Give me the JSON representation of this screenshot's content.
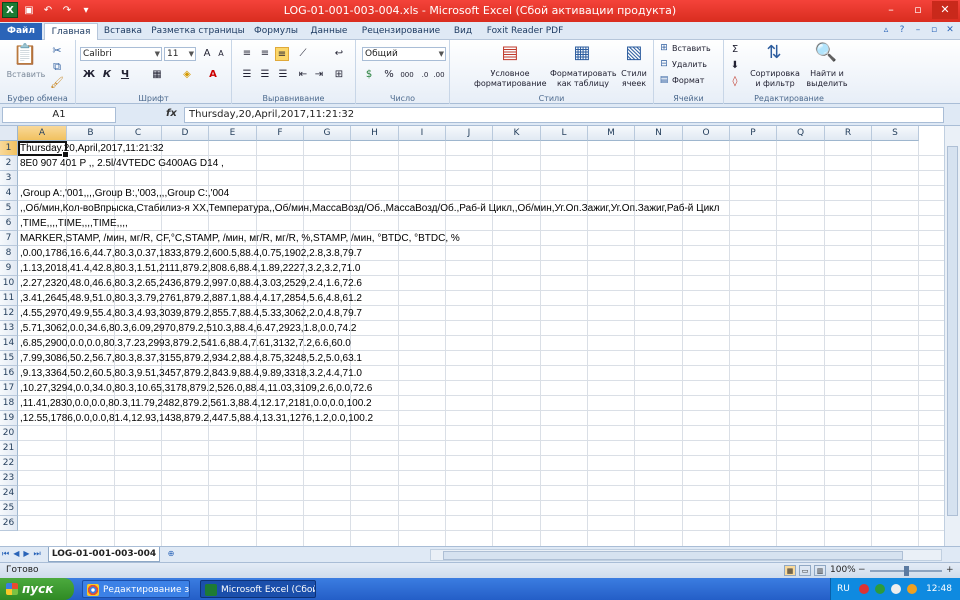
{
  "title": "LOG-01-001-003-004.xls  -  Microsoft Excel (Сбой активации продукта)",
  "tabs": [
    "Файл",
    "Главная",
    "Вставка",
    "Разметка страницы",
    "Формулы",
    "Данные",
    "Рецензирование",
    "Вид",
    "Foxit Reader PDF"
  ],
  "ribbon": {
    "clipboard": {
      "label": "Буфер обмена",
      "paste": "Вставить"
    },
    "font": {
      "label": "Шрифт",
      "name": "Calibri",
      "size": "11",
      "bold": "Ж",
      "italic": "К",
      "underline": "Ч"
    },
    "alignment": {
      "label": "Выравнивание"
    },
    "number": {
      "label": "Число",
      "format": "Общий",
      "percent": "%",
      "thousands": "000"
    },
    "styles": {
      "label": "Стили",
      "cond": "Условное форматирование",
      "cond_l1": "Условное",
      "cond_l2": "форматирование",
      "table_l1": "Форматировать",
      "table_l2": "как таблицу",
      "cell_l1": "Стили",
      "cell_l2": "ячеек"
    },
    "cells": {
      "label": "Ячейки",
      "insert": "Вставить",
      "delete": "Удалить",
      "format": "Формат"
    },
    "editing": {
      "label": "Редактирование",
      "sort_l1": "Сортировка",
      "sort_l2": "и фильтр",
      "find_l1": "Найти и",
      "find_l2": "выделить"
    }
  },
  "namebox": "A1",
  "fx": "fx",
  "formula": "Thursday,20,April,2017,11:21:32",
  "columns": [
    "A",
    "B",
    "C",
    "D",
    "E",
    "F",
    "G",
    "H",
    "I",
    "J",
    "K",
    "L",
    "M",
    "N",
    "O",
    "P",
    "Q",
    "R",
    "S"
  ],
  "rows": [
    "1",
    "2",
    "3",
    "4",
    "5",
    "6",
    "7",
    "8",
    "9",
    "10",
    "11",
    "12",
    "13",
    "14",
    "15",
    "16",
    "17",
    "18",
    "19",
    "20",
    "21",
    "22",
    "23",
    "24",
    "25",
    "26"
  ],
  "cells": [
    "Thursday,20,April,2017,11:21:32",
    "8E0 907 401 P  ,, 2.5l/4VTEDC G400AG D14  ,",
    "",
    ",Group A:,'001,,,,Group B:,'003,,,,Group C:,'004",
    ",,Об/мин,Кол-воВпрыска,Стабилиз-я XX,Температура,,Об/мин,МассаВозд/Об.,МассаВозд/Об.,Раб-й Цикл,,Об/мин,Уг.Оп.Зажиг,Уг.Оп.Зажиг,Раб-й Цикл",
    ",TIME,,,,TIME,,,,TIME,,,,",
    "MARKER,STAMP, /мин, мг/R, CF,°C,STAMP, /мин, мг/R, мг/R, %,STAMP, /мин, °BTDC, °BTDC, %",
    ",0.00,1786,16.6,44.7,80.3,0.37,1833,879.2,600.5,88.4,0.75,1902,2.8,3.8,79.7",
    ",1.13,2018,41.4,42.8,80.3,1.51,2111,879.2,808.6,88.4,1.89,2227,3.2,3.2,71.0",
    ",2.27,2320,48.0,46.6,80.3,2.65,2436,879.2,997.0,88.4,3.03,2529,2.4,1.6,72.6",
    ",3.41,2645,48.9,51.0,80.3,3.79,2761,879.2,887.1,88.4,4.17,2854,5.6,4.8,61.2",
    ",4.55,2970,49.9,55.4,80.3,4.93,3039,879.2,855.7,88.4,5.33,3062,2.0,4.8,79.7",
    ",5.71,3062,0.0,34.6,80.3,6.09,2970,879.2,510.3,88.4,6.47,2923,1.8,0.0,74.2",
    ",6.85,2900,0.0,0.0,80.3,7.23,2993,879.2,541.6,88.4,7.61,3132,7.2,6.6,60.0",
    ",7.99,3086,50.2,56.7,80.3,8.37,3155,879.2,934.2,88.4,8.75,3248,5.2,5.0,63.1",
    ",9.13,3364,50.2,60.5,80.3,9.51,3457,879.2,843.9,88.4,9.89,3318,3.2,4.4,71.0",
    ",10.27,3294,0.0,34.0,80.3,10.65,3178,879.2,526.0,88.4,11.03,3109,2.6,0.0,72.6",
    ",11.41,2830,0.0,0.0,80.3,11.79,2482,879.2,561.3,88.4,12.17,2181,0.0,0.0,100.2",
    ",12.55,1786,0.0,0.0,81.4,12.93,1438,879.2,447.5,88.4,13.31,1276,1.2,0.0,100.2"
  ],
  "sheet_tab": "LOG-01-001-003-004",
  "status": {
    "ready": "Готово",
    "zoom": "100%",
    "zoom_minus": "−",
    "zoom_plus": "+"
  },
  "taskbar": {
    "start": "пуск",
    "items": [
      "Редактирование за...",
      "Microsoft Excel (Сбой..."
    ],
    "lang": "RU",
    "clock": "12:48"
  }
}
